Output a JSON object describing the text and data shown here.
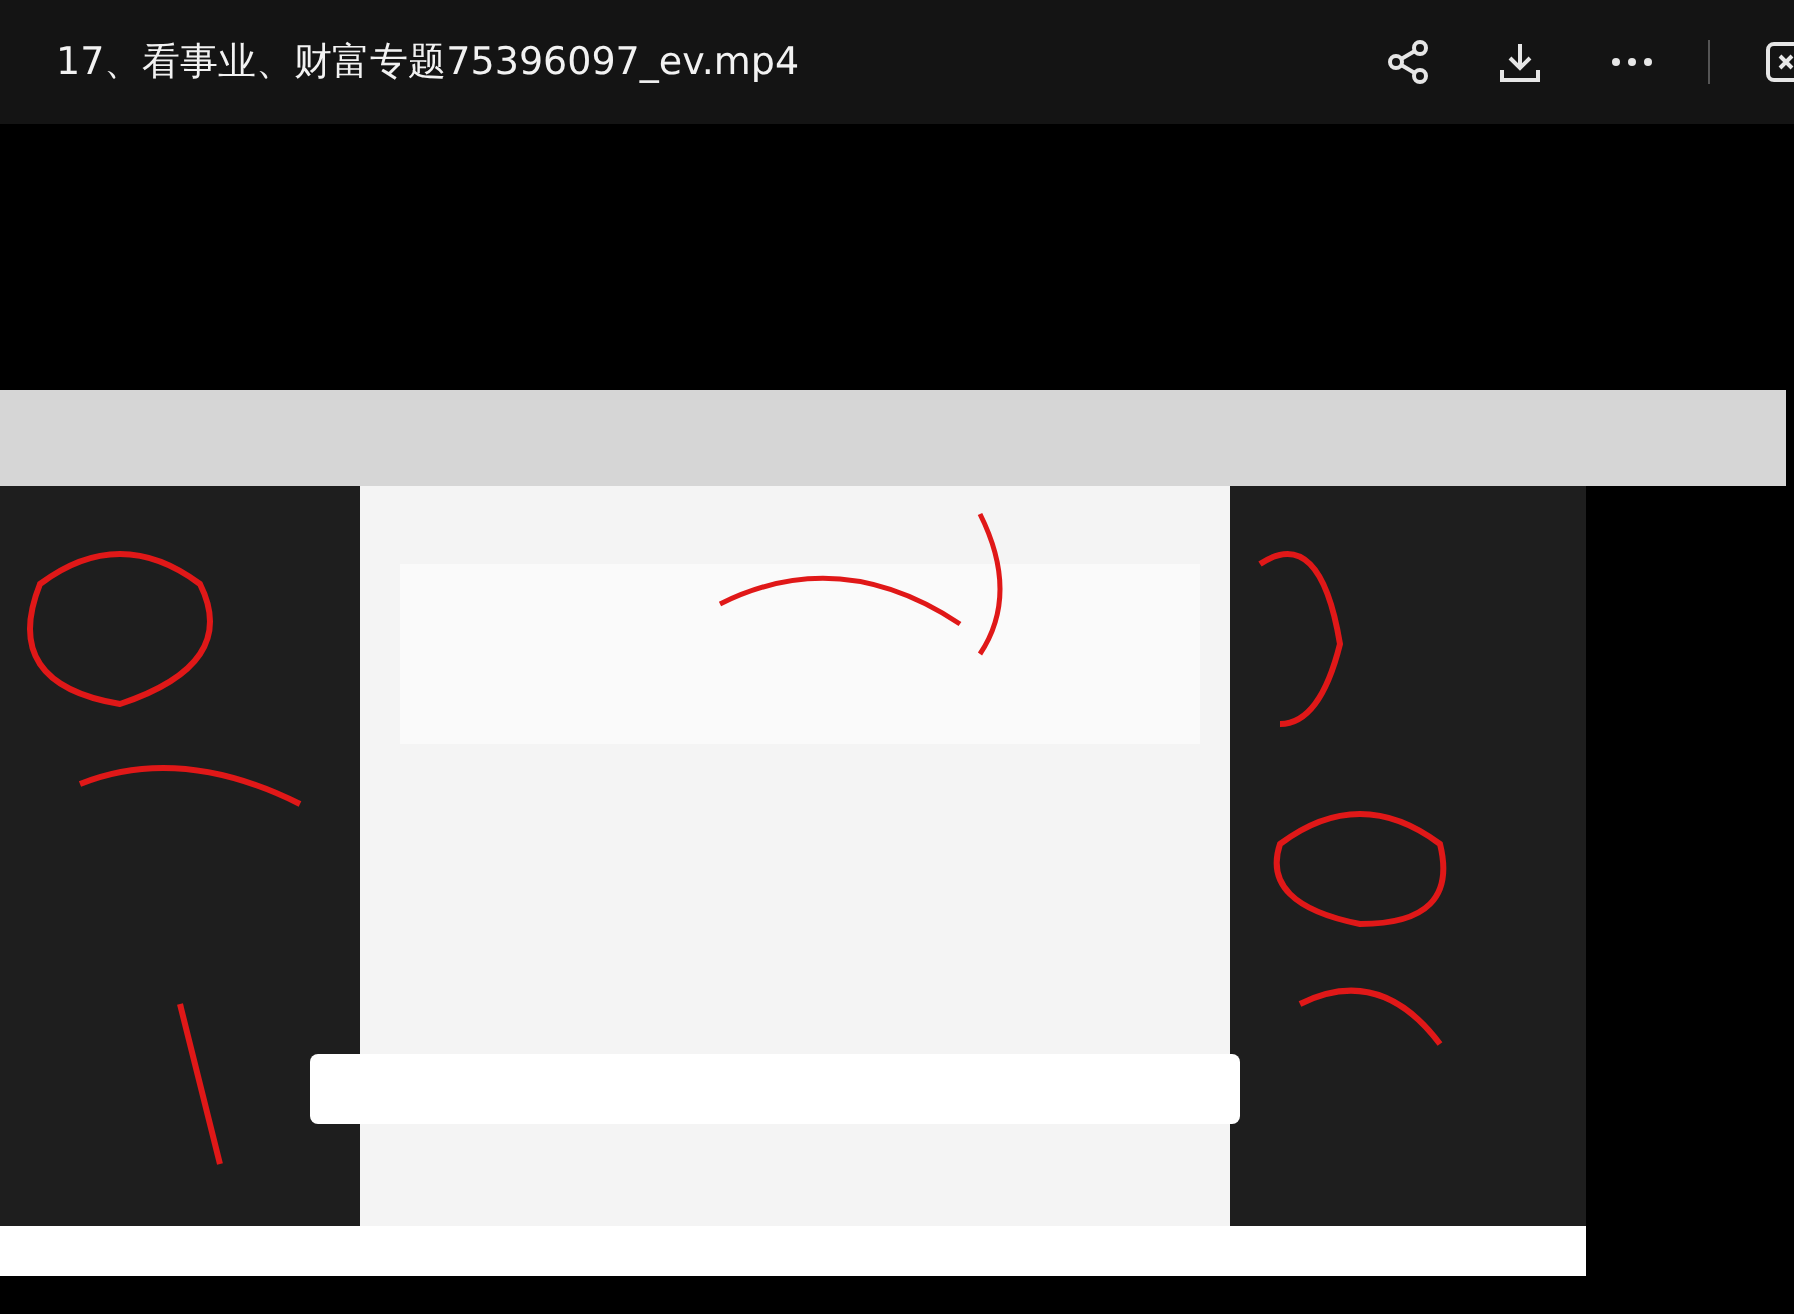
{
  "window": {
    "title": "17、看事业、财富专题75396097_ev.mp4"
  },
  "toolbar": [
    {
      "kind": "share"
    },
    {
      "kind": "download"
    },
    {
      "kind": "more"
    },
    {
      "kind": "exit"
    }
  ]
}
